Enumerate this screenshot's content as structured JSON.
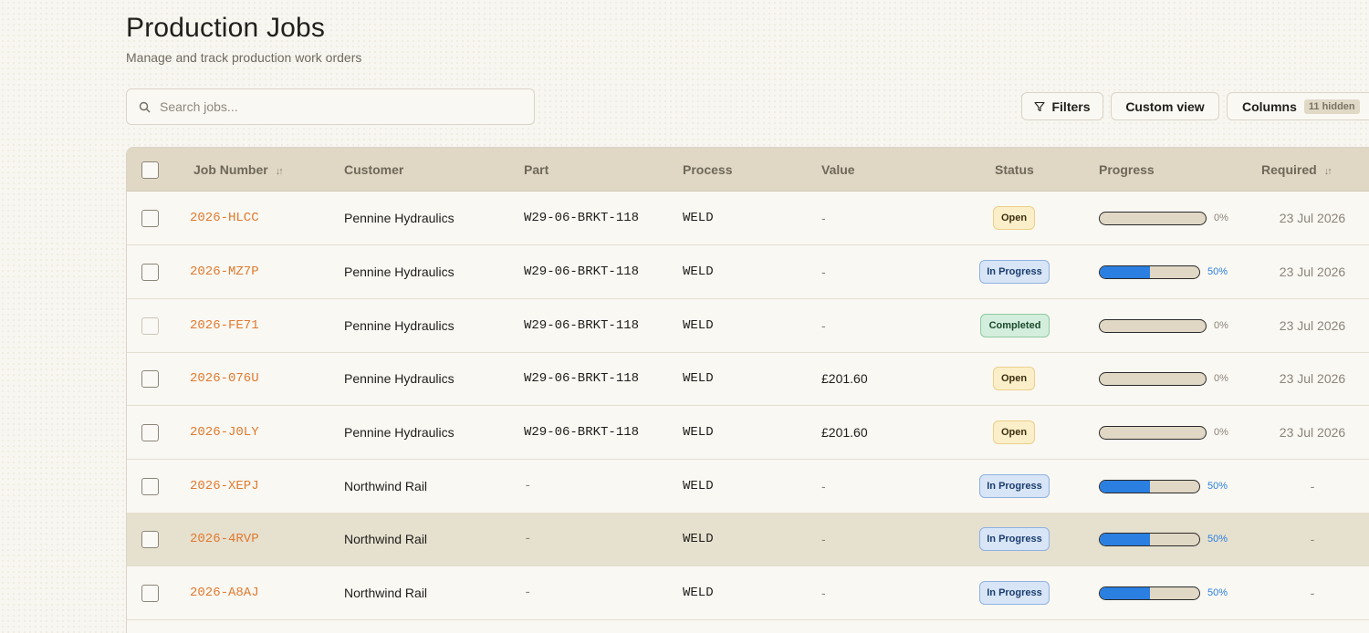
{
  "header": {
    "title": "Production Jobs",
    "subtitle": "Manage and track production work orders"
  },
  "search": {
    "placeholder": "Search jobs..."
  },
  "toolbar": {
    "filters_label": "Filters",
    "custom_view_label": "Custom view",
    "columns_label": "Columns",
    "hidden_badge": "11 hidden"
  },
  "table": {
    "columns": [
      "Job Number",
      "Customer",
      "Part",
      "Process",
      "Value",
      "Status",
      "Progress",
      "Required"
    ],
    "rows": [
      {
        "job": "2026-HLCC",
        "customer": "Pennine Hydraulics",
        "part": "W29-06-BRKT-118",
        "process": "WELD",
        "value": "-",
        "status": "Open",
        "progress_label": "0%",
        "progress": 0,
        "required": "23 Jul 2026",
        "checkbox_disabled": false
      },
      {
        "job": "2026-MZ7P",
        "customer": "Pennine Hydraulics",
        "part": "W29-06-BRKT-118",
        "process": "WELD",
        "value": "-",
        "status": "In Progress",
        "progress_label": "50%",
        "progress": 0.5,
        "required": "23 Jul 2026",
        "checkbox_disabled": false
      },
      {
        "job": "2026-FE71",
        "customer": "Pennine Hydraulics",
        "part": "W29-06-BRKT-118",
        "process": "WELD",
        "value": "-",
        "status": "Completed",
        "progress_label": "0%",
        "progress": 0,
        "required": "23 Jul 2026",
        "checkbox_disabled": true
      },
      {
        "job": "2026-076U",
        "customer": "Pennine Hydraulics",
        "part": "W29-06-BRKT-118",
        "process": "WELD",
        "value": "£201.60",
        "status": "Open",
        "progress_label": "0%",
        "progress": 0,
        "required": "23 Jul 2026",
        "checkbox_disabled": false
      },
      {
        "job": "2026-J0LY",
        "customer": "Pennine Hydraulics",
        "part": "W29-06-BRKT-118",
        "process": "WELD",
        "value": "£201.60",
        "status": "Open",
        "progress_label": "0%",
        "progress": 0,
        "required": "23 Jul 2026",
        "checkbox_disabled": false
      },
      {
        "job": "2026-XEPJ",
        "customer": "Northwind Rail",
        "part": "-",
        "process": "WELD",
        "value": "-",
        "status": "In Progress",
        "progress_label": "50%",
        "progress": 0.5,
        "required": "-",
        "checkbox_disabled": false
      },
      {
        "job": "2026-4RVP",
        "customer": "Northwind Rail",
        "part": "-",
        "process": "WELD",
        "value": "-",
        "status": "In Progress",
        "progress_label": "50%",
        "progress": 0.5,
        "required": "-",
        "checkbox_disabled": false
      },
      {
        "job": "2026-A8AJ",
        "customer": "Northwind Rail",
        "part": "-",
        "process": "WELD",
        "value": "-",
        "status": "In Progress",
        "progress_label": "50%",
        "progress": 0.5,
        "required": "-",
        "checkbox_disabled": false
      }
    ]
  },
  "colors": {
    "accent_orange": "#e07a2e",
    "progress_blue": "#2b7fe0",
    "header_bg": "#e0d8c5"
  }
}
